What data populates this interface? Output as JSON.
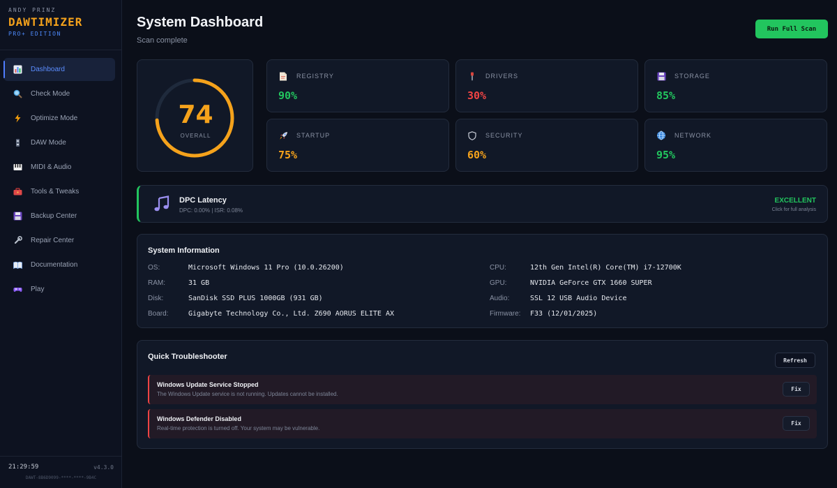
{
  "brand": {
    "author": "ANDY PRINZ",
    "name": "DAWTIMIZER",
    "edition": "PRO+ EDITION"
  },
  "sidebar": {
    "items": [
      {
        "label": "Dashboard",
        "icon": "chart-icon"
      },
      {
        "label": "Check Mode",
        "icon": "magnifier-icon"
      },
      {
        "label": "Optimize Mode",
        "icon": "lightning-icon"
      },
      {
        "label": "DAW Mode",
        "icon": "mixer-icon"
      },
      {
        "label": "MIDI & Audio",
        "icon": "piano-icon"
      },
      {
        "label": "Tools & Tweaks",
        "icon": "toolbox-icon"
      },
      {
        "label": "Backup Center",
        "icon": "floppy-icon"
      },
      {
        "label": "Repair Center",
        "icon": "wrench-icon"
      },
      {
        "label": "Documentation",
        "icon": "book-icon"
      },
      {
        "label": "Play",
        "icon": "gamepad-icon"
      }
    ],
    "active_index": 0
  },
  "footer": {
    "clock": "21:29:59",
    "version": "v4.3.0",
    "hwid": "DAWT-8B6D9099-****-****-9B4C"
  },
  "header": {
    "title": "System Dashboard",
    "subtitle": "Scan complete",
    "scan_button": "Run Full Scan"
  },
  "overall": {
    "score": "74",
    "score_fraction": 0.74,
    "label": "OVERALL"
  },
  "stats": [
    {
      "label": "REGISTRY",
      "value": "90%",
      "icon": "document-icon",
      "color": "#22c55e"
    },
    {
      "label": "DRIVERS",
      "value": "30%",
      "icon": "screwdriver-icon",
      "color": "#ef4444"
    },
    {
      "label": "STORAGE",
      "value": "85%",
      "icon": "floppy-icon",
      "color": "#22c55e"
    },
    {
      "label": "STARTUP",
      "value": "75%",
      "icon": "rocket-icon",
      "color": "#f5a21b"
    },
    {
      "label": "SECURITY",
      "value": "60%",
      "icon": "shield-icon",
      "color": "#f5a21b"
    },
    {
      "label": "NETWORK",
      "value": "95%",
      "icon": "globe-icon",
      "color": "#22c55e"
    }
  ],
  "dpc": {
    "title": "DPC Latency",
    "subtitle": "DPC: 0.00% | ISR: 0.08%",
    "status": "EXCELLENT",
    "hint": "Click for full analysis",
    "icon": "music-note-icon"
  },
  "system_info": {
    "title": "System Information",
    "left": [
      {
        "key": "OS:",
        "value": "Microsoft Windows 11 Pro (10.0.26200)"
      },
      {
        "key": "RAM:",
        "value": "31 GB"
      },
      {
        "key": "Disk:",
        "value": "SanDisk SSD PLUS 1000GB (931 GB)"
      },
      {
        "key": "Board:",
        "value": "Gigabyte Technology Co., Ltd. Z690 AORUS ELITE AX"
      }
    ],
    "right": [
      {
        "key": "CPU:",
        "value": "12th Gen Intel(R) Core(TM) i7-12700K"
      },
      {
        "key": "GPU:",
        "value": "NVIDIA GeForce GTX 1660 SUPER"
      },
      {
        "key": "Audio:",
        "value": "SSL 12 USB Audio Device"
      },
      {
        "key": "Firmware:",
        "value": "F33 (12/01/2025)"
      }
    ]
  },
  "troubleshooter": {
    "title": "Quick Troubleshooter",
    "refresh_label": "Refresh",
    "issues": [
      {
        "title": "Windows Update Service Stopped",
        "description": "The Windows Update service is not running. Updates cannot be installed.",
        "fix_label": "Fix"
      },
      {
        "title": "Windows Defender Disabled",
        "description": "Real-time protection is turned off. Your system may be vulnerable.",
        "fix_label": "Fix"
      }
    ]
  },
  "colors": {
    "accent": "#f5a21b",
    "good": "#22c55e",
    "bad": "#ef4444",
    "link": "#4f8cff"
  }
}
